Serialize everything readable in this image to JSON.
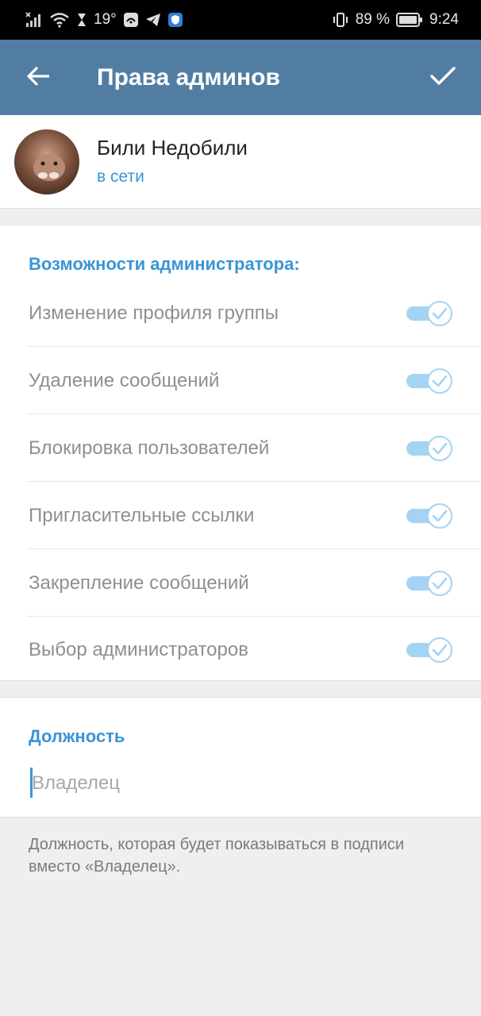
{
  "status_bar": {
    "temperature": "19°",
    "battery_percent": "89 %",
    "time": "9:24",
    "icons": [
      "signal-icon",
      "wifi-icon",
      "hourglass-icon",
      "weather-icon",
      "tool-icon",
      "telegram-icon",
      "shield-icon",
      "vibrate-icon",
      "battery-icon"
    ]
  },
  "toolbar": {
    "title": "Права админов",
    "back_icon": "arrow-left-icon",
    "done_icon": "checkmark-icon",
    "color": "#527da3"
  },
  "user": {
    "name": "Били Недобили",
    "status": "в сети"
  },
  "permissions": {
    "header": "Возможности администратора:",
    "items": [
      {
        "label": "Изменение профиля группы",
        "enabled": true
      },
      {
        "label": "Удаление сообщений",
        "enabled": true
      },
      {
        "label": "Блокировка пользователей",
        "enabled": true
      },
      {
        "label": "Пригласительные ссылки",
        "enabled": true
      },
      {
        "label": "Закрепление сообщений",
        "enabled": true
      },
      {
        "label": "Выбор администраторов",
        "enabled": true
      }
    ]
  },
  "custom_title": {
    "header": "Должность",
    "value": "",
    "placeholder": "Владелец",
    "hint": "Должность, которая будет показываться в подписи вместо «Владелец»."
  },
  "colors": {
    "accent": "#3a95d5",
    "toggle_on": "#a5d3f3"
  }
}
